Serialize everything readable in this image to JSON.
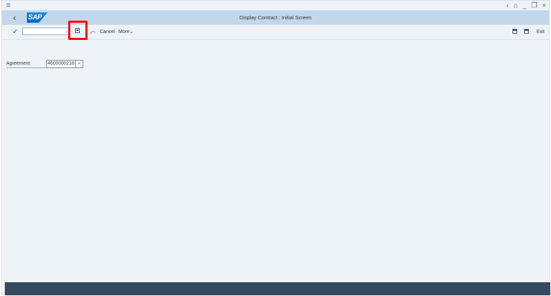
{
  "header": {
    "title": "Display Contract : Initial Screen",
    "logo_text": "SAP",
    "back_icon": "‹"
  },
  "system": {
    "menu_icon": "≡",
    "controls": [
      "‹",
      "⌂",
      "_",
      "❐",
      "×"
    ]
  },
  "toolbar": {
    "check_icon": "✓",
    "command_value": "",
    "nav_icon": "⤺",
    "cancel_label": "Cancel",
    "more_label": "More",
    "more_chevron": "⌄",
    "exit_label": "Exit"
  },
  "form": {
    "agreement_label": "Agreement:",
    "agreement_value": "4600000218",
    "value_help_icon": "⌕"
  },
  "colors": {
    "header_bg": "#c2d7ea",
    "page_bg": "#eef3f8",
    "footer_bg": "#354a5f",
    "highlight": "#ff0000"
  }
}
